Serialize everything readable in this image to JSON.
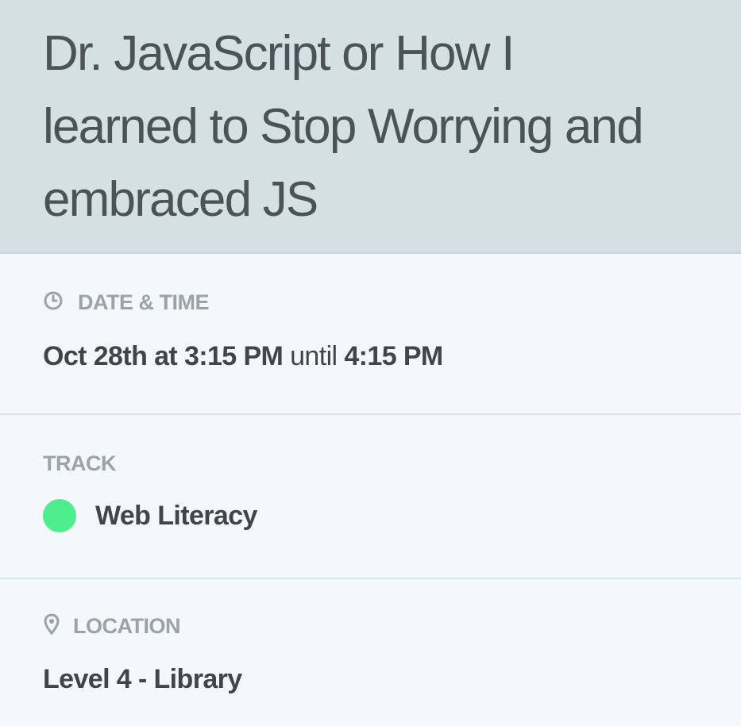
{
  "session": {
    "title_line1": "Dr. JavaScript or How I",
    "title_line2": "learned to Stop Worrying and",
    "title_line3": "embraced JS"
  },
  "datetime": {
    "icon": "clock-icon",
    "label": "DATE & TIME",
    "start": "Oct 28th at 3:15 PM",
    "connector": "until",
    "end": "4:15 PM"
  },
  "track": {
    "label": "TRACK",
    "name": "Web Literacy",
    "color": "#4eee8f"
  },
  "location": {
    "icon": "map-pin-icon",
    "label": "LOCATION",
    "value": "Level 4 - Library"
  }
}
